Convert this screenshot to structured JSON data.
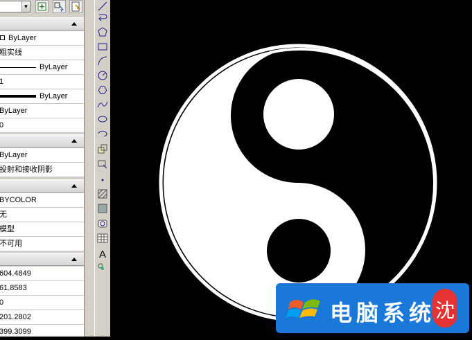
{
  "properties": {
    "sections": [
      {
        "rows": [
          "ByLayer",
          "粗实线",
          "ByLayer",
          "1",
          "ByLayer",
          "ByLayer",
          "0"
        ]
      },
      {
        "rows": [
          "ByLayer",
          "投射和接收阴影"
        ]
      },
      {
        "rows": [
          "BYCOLOR",
          "无",
          "模型",
          "不可用"
        ]
      },
      {
        "rows": [
          "604.4849",
          "61.8583",
          "0",
          "201.2802",
          "399.3099"
        ]
      }
    ]
  },
  "watermark": {
    "text": "电脑系统",
    "pill_glyph": "沈"
  },
  "colors": {
    "panel": "#d4d0c8",
    "canvas": "#000000",
    "badge": "#1a78d8",
    "pill": "#e53232"
  },
  "icons": [
    "line-icon",
    "arc-return-icon",
    "polygon-icon",
    "rectangle-icon",
    "arc-icon",
    "circle-icon",
    "revision-cloud-icon",
    "spline-icon",
    "ellipse-icon",
    "ellipse-arc-icon",
    "insert-block-icon",
    "make-block-icon",
    "point-icon",
    "hatch-icon",
    "gradient-icon",
    "region-icon",
    "table-icon",
    "text-icon",
    "add-selected-icon"
  ]
}
